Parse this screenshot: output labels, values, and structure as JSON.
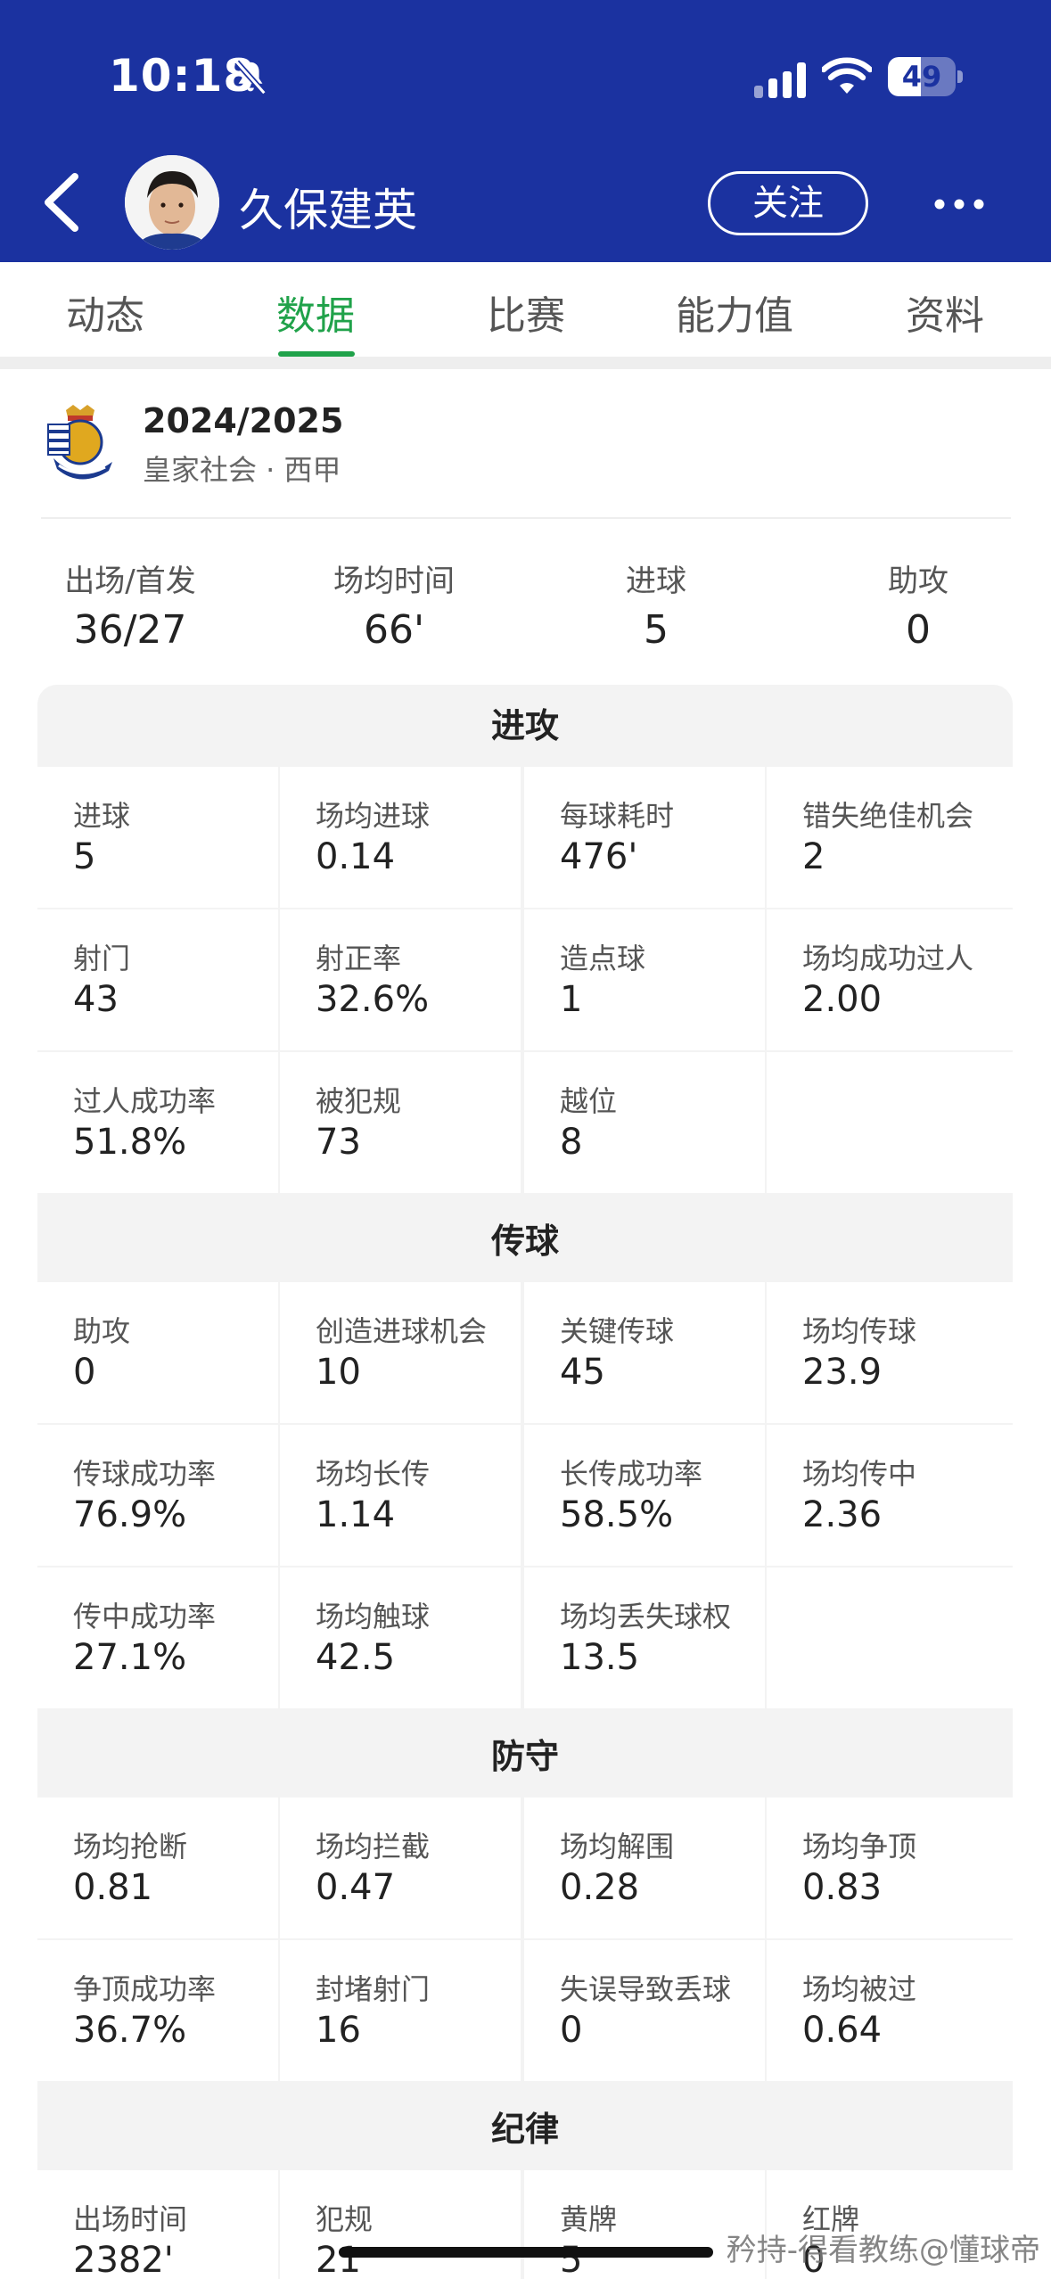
{
  "status_bar": {
    "time": "10:18",
    "battery": "49",
    "battery_level": 0.49
  },
  "header": {
    "player_name": "久保建英",
    "follow_label": "关注"
  },
  "tabs": [
    {
      "label": "动态",
      "active": false
    },
    {
      "label": "数据",
      "active": true
    },
    {
      "label": "比赛",
      "active": false
    },
    {
      "label": "能力值",
      "active": false
    },
    {
      "label": "资料",
      "active": false
    }
  ],
  "season": {
    "title": "2024/2025",
    "team_league": "皇家社会 · 西甲"
  },
  "summary": [
    {
      "label": "出场/首发",
      "value": "36/27"
    },
    {
      "label": "场均时间",
      "value": "66'"
    },
    {
      "label": "进球",
      "value": "5"
    },
    {
      "label": "助攻",
      "value": "0"
    }
  ],
  "sections": [
    {
      "title": "进攻",
      "stats": [
        {
          "label": "进球",
          "value": "5"
        },
        {
          "label": "场均进球",
          "value": "0.14"
        },
        {
          "label": "每球耗时",
          "value": "476'"
        },
        {
          "label": "错失绝佳机会",
          "value": "2"
        },
        {
          "label": "射门",
          "value": "43"
        },
        {
          "label": "射正率",
          "value": "32.6%"
        },
        {
          "label": "造点球",
          "value": "1"
        },
        {
          "label": "场均成功过人",
          "value": "2.00"
        },
        {
          "label": "过人成功率",
          "value": "51.8%"
        },
        {
          "label": "被犯规",
          "value": "73"
        },
        {
          "label": "越位",
          "value": "8"
        },
        {
          "label": "",
          "value": ""
        }
      ]
    },
    {
      "title": "传球",
      "stats": [
        {
          "label": "助攻",
          "value": "0"
        },
        {
          "label": "创造进球机会",
          "value": "10"
        },
        {
          "label": "关键传球",
          "value": "45"
        },
        {
          "label": "场均传球",
          "value": "23.9"
        },
        {
          "label": "传球成功率",
          "value": "76.9%"
        },
        {
          "label": "场均长传",
          "value": "1.14"
        },
        {
          "label": "长传成功率",
          "value": "58.5%"
        },
        {
          "label": "场均传中",
          "value": "2.36"
        },
        {
          "label": "传中成功率",
          "value": "27.1%"
        },
        {
          "label": "场均触球",
          "value": "42.5"
        },
        {
          "label": "场均丢失球权",
          "value": "13.5"
        },
        {
          "label": "",
          "value": ""
        }
      ]
    },
    {
      "title": "防守",
      "stats": [
        {
          "label": "场均抢断",
          "value": "0.81"
        },
        {
          "label": "场均拦截",
          "value": "0.47"
        },
        {
          "label": "场均解围",
          "value": "0.28"
        },
        {
          "label": "场均争顶",
          "value": "0.83"
        },
        {
          "label": "争顶成功率",
          "value": "36.7%"
        },
        {
          "label": "封堵射门",
          "value": "16"
        },
        {
          "label": "失误导致丢球",
          "value": "0"
        },
        {
          "label": "场均被过",
          "value": "0.64"
        }
      ]
    },
    {
      "title": "纪律",
      "stats": [
        {
          "label": "出场时间",
          "value": "2382'"
        },
        {
          "label": "犯规",
          "value": "21"
        },
        {
          "label": "黄牌",
          "value": "5"
        },
        {
          "label": "红牌",
          "value": "0"
        }
      ]
    }
  ],
  "watermark": "矜持-得看教练@懂球帝",
  "colors": {
    "header_bg": "#1b32a0",
    "accent_green": "#20a24a"
  },
  "icons": [
    "bell-mute-icon",
    "signal-icon",
    "wifi-icon",
    "battery-icon",
    "back-arrow-icon",
    "more-icon",
    "club-crest-icon"
  ]
}
